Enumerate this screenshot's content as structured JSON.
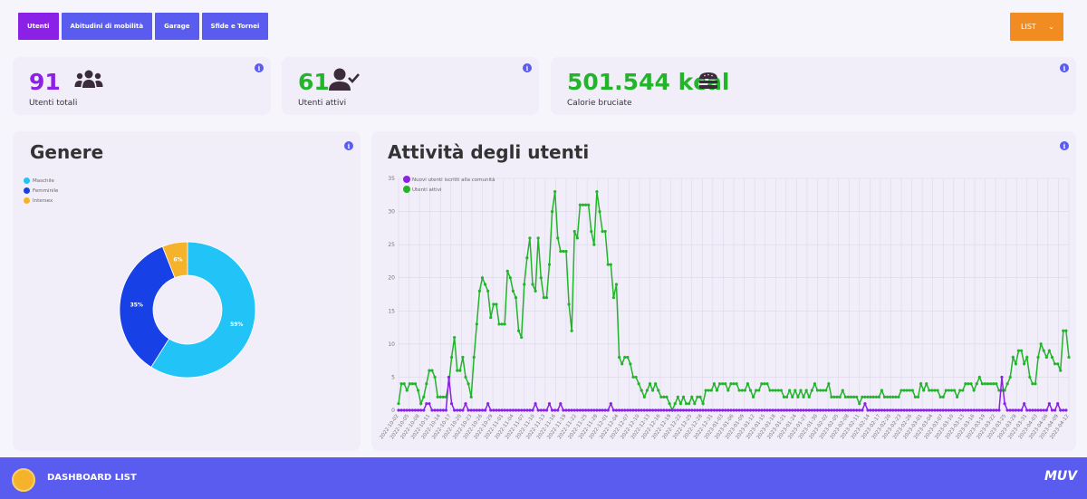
{
  "tabs": [
    {
      "label": "Utenti",
      "active": true
    },
    {
      "label": "Abitudini di mobilità",
      "active": false
    },
    {
      "label": "Garage",
      "active": false
    },
    {
      "label": "Sfide e Tornei",
      "active": false
    }
  ],
  "view_select": {
    "label": "LIST",
    "icon": "chevron-down-icon"
  },
  "kpis": {
    "total_users": {
      "value": "91",
      "label": "Utenti totali",
      "color": "#8b20e6",
      "icon": "users-group-icon"
    },
    "active_users": {
      "value": "61",
      "label": "Utenti attivi",
      "color": "#22b52a",
      "icon": "user-check-icon"
    },
    "calories": {
      "value": "501.544 kcal",
      "label": "Calorie bruciate",
      "color": "#22b52a",
      "icon": "burger-icon"
    }
  },
  "info_glyph": "i",
  "gender_card": {
    "title": "Genere",
    "chart_data": {
      "type": "pie",
      "categories": [
        "Maschile",
        "Femminile",
        "Intersex"
      ],
      "values": [
        59,
        35,
        6
      ],
      "colors": [
        "#22c4f7",
        "#1740e6",
        "#f5b32b"
      ],
      "data_labels": [
        "59%",
        "35%",
        "6%"
      ],
      "legend_position": "top-left"
    }
  },
  "activity_card": {
    "title": "Attività degli utenti",
    "chart_data": {
      "type": "line",
      "ylim": [
        0,
        35
      ],
      "y_ticks": [
        "0",
        "5",
        "10",
        "15",
        "20",
        "25",
        "30",
        "35"
      ],
      "x_tick_labels": [
        "2022-10-02",
        "2022-10-05",
        "2022-10-08",
        "2022-10-11",
        "2022-10-14",
        "2022-10-17",
        "2022-10-20",
        "2022-10-23",
        "2022-10-26",
        "2022-10-29",
        "2022-11-01",
        "2022-11-04",
        "2022-11-07",
        "2022-11-10",
        "2022-11-13",
        "2022-11-16",
        "2022-11-19",
        "2022-11-22",
        "2022-11-25",
        "2022-11-28",
        "2022-12-01",
        "2022-12-04",
        "2022-12-07",
        "2022-12-10",
        "2022-12-13",
        "2022-12-16",
        "2022-12-19",
        "2022-12-22",
        "2022-12-25",
        "2022-12-28",
        "2022-12-31",
        "2023-01-03",
        "2023-01-06",
        "2023-01-09",
        "2023-01-12",
        "2023-01-15",
        "2023-01-18",
        "2023-01-21",
        "2023-01-24",
        "2023-01-27",
        "2023-01-30",
        "2023-02-02",
        "2023-02-05",
        "2023-02-08",
        "2023-02-11",
        "2023-02-14",
        "2023-02-17",
        "2023-02-20",
        "2023-02-23",
        "2023-02-26",
        "2023-03-01",
        "2023-03-04",
        "2023-03-07",
        "2023-03-10",
        "2023-03-13",
        "2023-03-16",
        "2023-03-19",
        "2023-03-22",
        "2023-03-25",
        "2023-03-28",
        "2023-03-31",
        "2023-04-03",
        "2023-04-06",
        "2023-04-09",
        "2023-04-12"
      ],
      "legend_position": "top-left",
      "grid": true,
      "series": [
        {
          "name": "Nuovi utenti iscritti alla comunità",
          "color": "#8b20e6",
          "values": [
            0,
            0,
            0,
            0,
            0,
            0,
            0,
            0,
            0,
            0,
            1,
            1,
            0,
            0,
            0,
            0,
            0,
            0,
            5,
            1,
            0,
            0,
            0,
            0,
            1,
            0,
            0,
            0,
            0,
            0,
            0,
            0,
            1,
            0,
            0,
            0,
            0,
            0,
            0,
            0,
            0,
            0,
            0,
            0,
            0,
            0,
            0,
            0,
            0,
            1,
            0,
            0,
            0,
            0,
            1,
            0,
            0,
            0,
            1,
            0,
            0,
            0,
            0,
            0,
            0,
            0,
            0,
            0,
            0,
            0,
            0,
            0,
            0,
            0,
            0,
            0,
            1,
            0,
            0,
            0,
            0,
            0,
            0,
            0,
            0,
            0,
            0,
            0,
            0,
            0,
            0,
            0,
            0,
            0,
            0,
            0,
            0,
            0,
            0,
            0,
            0,
            0,
            0,
            0,
            0,
            0,
            0,
            0,
            0,
            0,
            0,
            0,
            0,
            0,
            0,
            0,
            0,
            0,
            0,
            0,
            0,
            0,
            0,
            0,
            0,
            0,
            0,
            0,
            0,
            0,
            0,
            0,
            0,
            0,
            0,
            0,
            0,
            0,
            0,
            0,
            0,
            0,
            0,
            0,
            0,
            0,
            0,
            0,
            0,
            0,
            0,
            0,
            0,
            0,
            0,
            0,
            0,
            0,
            0,
            0,
            0,
            0,
            0,
            0,
            0,
            0,
            0,
            1,
            0,
            0,
            0,
            0,
            0,
            0,
            0,
            0,
            0,
            0,
            0,
            0,
            0,
            0,
            0,
            0,
            0,
            0,
            0,
            0,
            0,
            0,
            0,
            0,
            0,
            0,
            0,
            0,
            0,
            0,
            0,
            0,
            0,
            0,
            0,
            0,
            0,
            0,
            0,
            0,
            0,
            0,
            0,
            0,
            0,
            0,
            0,
            0,
            5,
            1,
            0,
            0,
            0,
            0,
            0,
            0,
            1,
            0,
            0,
            0,
            0,
            0,
            0,
            0,
            0,
            1,
            0,
            0,
            1,
            0,
            0,
            0
          ]
        },
        {
          "name": "Utenti attivi",
          "color": "#22b52a",
          "values": [
            1,
            4,
            4,
            3,
            4,
            4,
            4,
            3,
            1,
            2,
            4,
            6,
            6,
            5,
            2,
            2,
            2,
            2,
            4,
            8,
            11,
            6,
            6,
            8,
            5,
            4,
            2,
            8,
            13,
            18,
            20,
            19,
            18,
            14,
            16,
            16,
            13,
            13,
            13,
            21,
            20,
            18,
            17,
            12,
            11,
            19,
            23,
            26,
            19,
            18,
            26,
            20,
            17,
            17,
            22,
            30,
            33,
            26,
            24,
            24,
            24,
            16,
            12,
            27,
            26,
            31,
            31,
            31,
            31,
            27,
            25,
            33,
            30,
            27,
            27,
            22,
            22,
            17,
            19,
            8,
            7,
            8,
            8,
            7,
            5,
            5,
            4,
            3,
            2,
            3,
            4,
            3,
            4,
            3,
            2,
            2,
            2,
            1,
            0,
            1,
            2,
            1,
            2,
            1,
            1,
            2,
            1,
            2,
            2,
            1,
            3,
            3,
            3,
            4,
            3,
            4,
            4,
            4,
            3,
            4,
            4,
            4,
            3,
            3,
            3,
            4,
            3,
            2,
            3,
            3,
            4,
            4,
            4,
            3,
            3,
            3,
            3,
            3,
            2,
            2,
            3,
            2,
            3,
            2,
            3,
            2,
            3,
            2,
            3,
            4,
            3,
            3,
            3,
            3,
            4,
            2,
            2,
            2,
            2,
            3,
            2,
            2,
            2,
            2,
            2,
            1,
            2,
            2,
            2,
            2,
            2,
            2,
            2,
            3,
            2,
            2,
            2,
            2,
            2,
            2,
            3,
            3,
            3,
            3,
            3,
            2,
            2,
            4,
            3,
            4,
            3,
            3,
            3,
            3,
            2,
            2,
            3,
            3,
            3,
            3,
            2,
            3,
            3,
            4,
            4,
            4,
            3,
            4,
            5,
            4,
            4,
            4,
            4,
            4,
            4,
            3,
            3,
            3,
            4,
            5,
            8,
            7,
            9,
            9,
            7,
            8,
            5,
            4,
            4,
            8,
            10,
            9,
            8,
            9,
            8,
            7,
            7,
            6,
            12,
            12,
            8
          ]
        }
      ]
    }
  },
  "footer": {
    "title": "DASHBOARD LIST",
    "brand": "MUV"
  }
}
